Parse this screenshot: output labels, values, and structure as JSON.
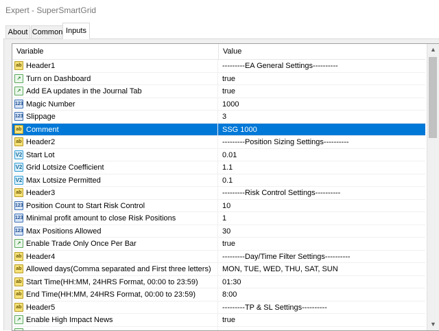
{
  "window": {
    "title": "Expert - SuperSmartGrid"
  },
  "tabs": [
    {
      "label": "About",
      "active": false
    },
    {
      "label": "Common",
      "active": false
    },
    {
      "label": "Inputs",
      "active": true
    }
  ],
  "columns": {
    "variable": "Variable",
    "value": "Value"
  },
  "rows": [
    {
      "icon": "ab",
      "name": "Header1",
      "value": "---------EA General Settings----------"
    },
    {
      "icon": "bool",
      "name": "Turn on Dashboard",
      "value": "true"
    },
    {
      "icon": "bool",
      "name": "Add EA updates in the Journal Tab",
      "value": "true"
    },
    {
      "icon": "int",
      "name": "Magic Number",
      "value": "1000"
    },
    {
      "icon": "int",
      "name": "Slippage",
      "value": "3"
    },
    {
      "icon": "ab",
      "name": "Comment",
      "value": "SSG 1000",
      "selected": true
    },
    {
      "icon": "ab",
      "name": "Header2",
      "value": "---------Position Sizing Settings----------"
    },
    {
      "icon": "dbl",
      "name": "Start Lot",
      "value": "0.01"
    },
    {
      "icon": "dbl",
      "name": "Grid Lotsize Coefficient",
      "value": "1.1"
    },
    {
      "icon": "dbl",
      "name": "Max Lotsize Permitted",
      "value": "0.1"
    },
    {
      "icon": "ab",
      "name": "Header3",
      "value": "---------Risk Control Settings----------"
    },
    {
      "icon": "int",
      "name": "Position Count to Start Risk Control",
      "value": "10"
    },
    {
      "icon": "int",
      "name": "Minimal profit amount to close Risk Positions",
      "value": "1"
    },
    {
      "icon": "int",
      "name": "Max Positions Allowed",
      "value": "30"
    },
    {
      "icon": "bool",
      "name": "Enable Trade Only Once Per Bar",
      "value": "true"
    },
    {
      "icon": "ab",
      "name": "Header4",
      "value": "---------Day/Time Filter Settings----------"
    },
    {
      "icon": "ab",
      "name": "Allowed days(Comma separated and First three letters)",
      "value": "MON, TUE, WED, THU, SAT, SUN"
    },
    {
      "icon": "ab",
      "name": "Start Time(HH:MM, 24HRS Format, 00:00 to 23:59)",
      "value": "01:30"
    },
    {
      "icon": "ab",
      "name": "End Time(HH:MM, 24HRS Format, 00:00 to 23:59)",
      "value": "8:00"
    },
    {
      "icon": "ab",
      "name": "Header5",
      "value": "---------TP & SL Settings----------"
    },
    {
      "icon": "bool",
      "name": "Enable High Impact News",
      "value": "true"
    },
    {
      "icon": "bool",
      "name": "",
      "value": ""
    }
  ],
  "icon_glyphs": {
    "ab": "ab",
    "bool": "↗",
    "int": "123",
    "dbl": "V2"
  },
  "colors": {
    "selection": "#0078d7",
    "panel": "#f0f0f0"
  }
}
